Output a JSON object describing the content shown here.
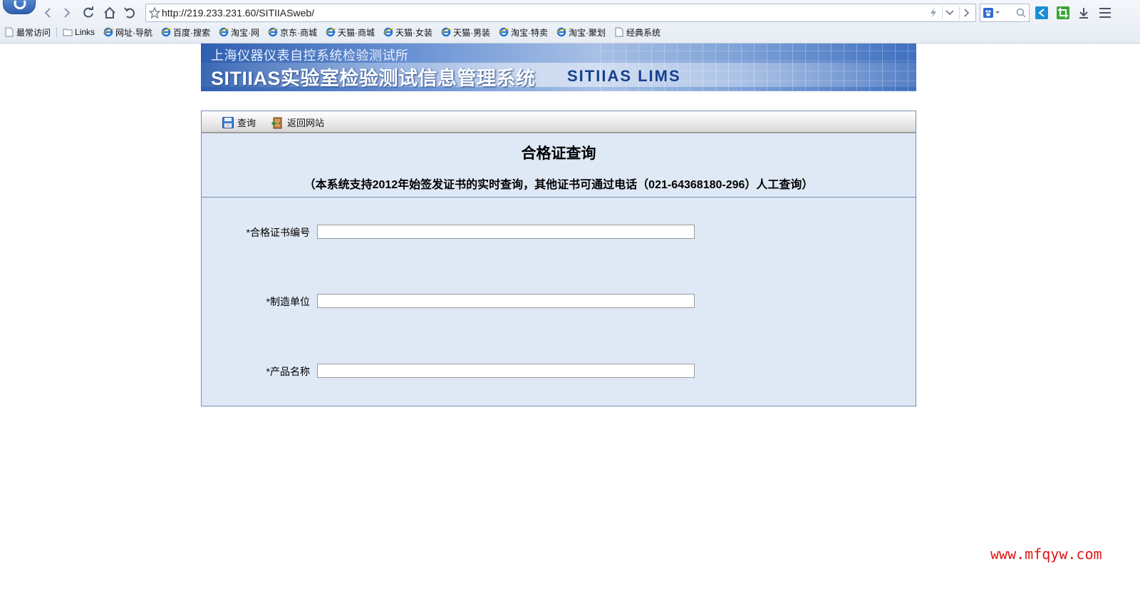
{
  "browser": {
    "url": "http://219.233.231.60/SITIIASweb/",
    "bookmarks": [
      {
        "label": "最常访问",
        "icon": "page-icon"
      },
      {
        "label": "Links",
        "icon": "folder-icon"
      },
      {
        "label": "网址·导航",
        "icon": "ie-icon"
      },
      {
        "label": "百度·搜索",
        "icon": "ie-icon"
      },
      {
        "label": "淘宝·网",
        "icon": "ie-icon"
      },
      {
        "label": "京东·商城",
        "icon": "ie-icon"
      },
      {
        "label": "天猫·商城",
        "icon": "ie-icon"
      },
      {
        "label": "天猫·女装",
        "icon": "ie-icon"
      },
      {
        "label": "天猫·男装",
        "icon": "ie-icon"
      },
      {
        "label": "淘宝·特卖",
        "icon": "ie-icon"
      },
      {
        "label": "淘宝·聚划",
        "icon": "ie-icon"
      },
      {
        "label": "经典系统",
        "icon": "page-icon"
      }
    ]
  },
  "banner": {
    "org": "上海仪器仪表自控系统检验测试所",
    "title": "SITIIAS实验室检验测试信息管理系统",
    "title_en": "SITIIAS LIMS"
  },
  "toolbar": {
    "query_label": "查询",
    "back_label": "返回网站"
  },
  "form": {
    "title": "合格证查询",
    "note": "（本系统支持2012年始签发证书的实时查询，其他证书可通过电话（021-64368180-296）人工查询）",
    "fields": [
      {
        "label": "*合格证书编号",
        "value": ""
      },
      {
        "label": "*制造单位",
        "value": ""
      },
      {
        "label": "*产品名称",
        "value": ""
      }
    ]
  },
  "watermark": "www.mfqyw.com"
}
